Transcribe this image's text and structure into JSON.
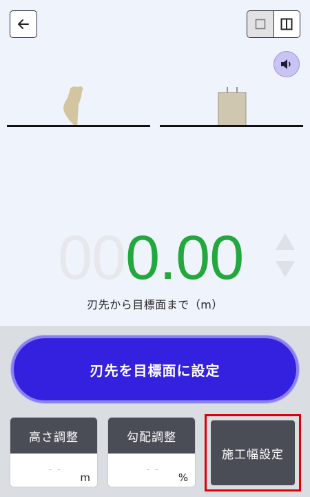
{
  "header": {
    "back_icon": "arrow-left-icon",
    "view_toggle": {
      "single_icon": "square-icon",
      "split_icon": "split-view-icon",
      "active": "split"
    },
    "sound_icon": "speaker-icon"
  },
  "scene": {
    "bucket_color": "#d3c5a0",
    "tank_color": "#cfc7b0"
  },
  "distance": {
    "leading_digits": "00",
    "value": "0.00",
    "label": "刃先から目標面まで（m）",
    "value_color": "#22a83c"
  },
  "controls": {
    "set_target_label": "刃先を目標面に設定",
    "height_adjust": {
      "label": "高さ調整",
      "placeholder": "- -",
      "unit": "m"
    },
    "slope_adjust": {
      "label": "勾配調整",
      "placeholder": "- -",
      "unit": "%"
    },
    "width_setting_label": "施工幅設定",
    "accent": "#3421df",
    "highlight": "#e00000"
  }
}
